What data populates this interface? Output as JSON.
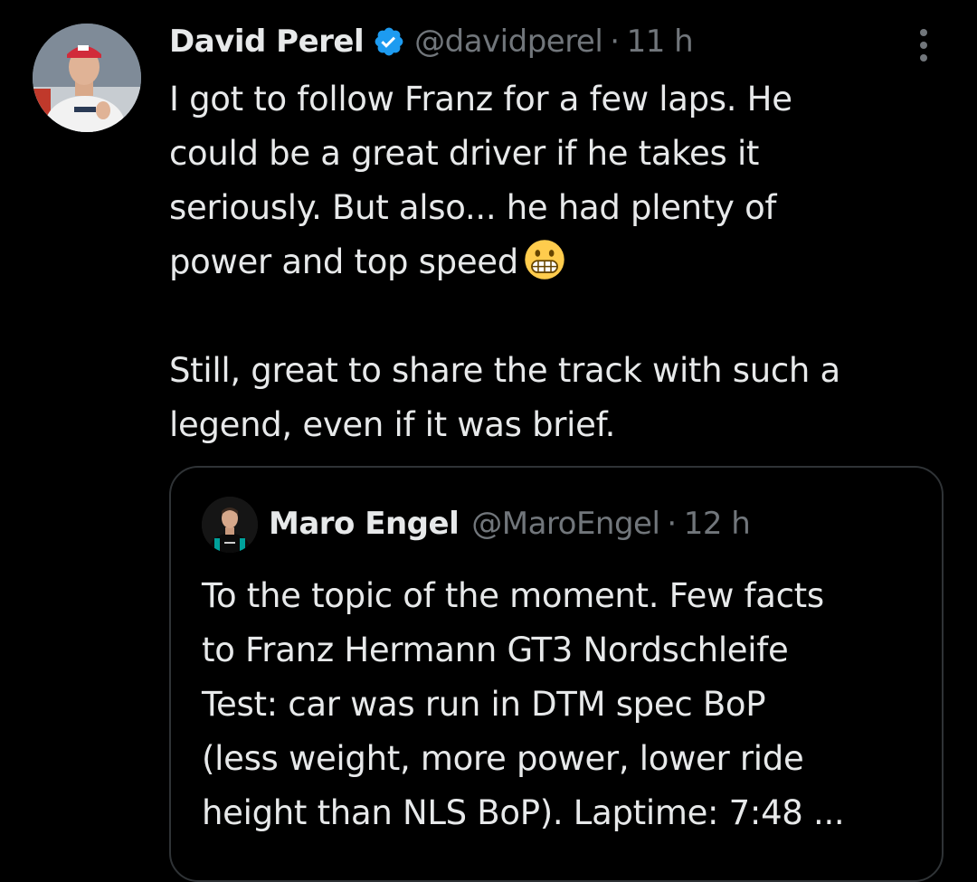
{
  "tweet": {
    "author": {
      "display_name": "David Perel",
      "handle": "@davidperel",
      "verified_icon": "verified-badge-icon",
      "avatar": "profile-photo"
    },
    "time": "11 h",
    "separator": "·",
    "more_icon": "more-options-icon",
    "text_lines": [
      "I got to follow Franz for a few laps. He",
      "could be a great driver if he takes it",
      "seriously. But also... he had plenty of",
      "power and top speed"
    ],
    "emoji": "grimacing-face-emoji",
    "text_lines_2": [
      "Still, great to share the track with such a",
      "legend, even if it was brief."
    ]
  },
  "quoted_tweet": {
    "author": {
      "display_name": "Maro Engel",
      "handle": "@MaroEngel",
      "avatar": "profile-photo"
    },
    "time": "12 h",
    "separator": "·",
    "text_lines": [
      "To the topic of the moment. Few facts",
      "to Franz Hermann GT3 Nordschleife",
      "Test: car was run in DTM spec BoP",
      "(less weight, more power, lower ride",
      "height than NLS BoP). Laptime: 7:48 ..."
    ]
  },
  "colors": {
    "background": "#000000",
    "primary_text": "#e7e9ea",
    "secondary_text": "#71767b",
    "verified_blue": "#1d9bf0",
    "border": "#2f3336",
    "emoji_yellow": "#ffcc4d"
  }
}
